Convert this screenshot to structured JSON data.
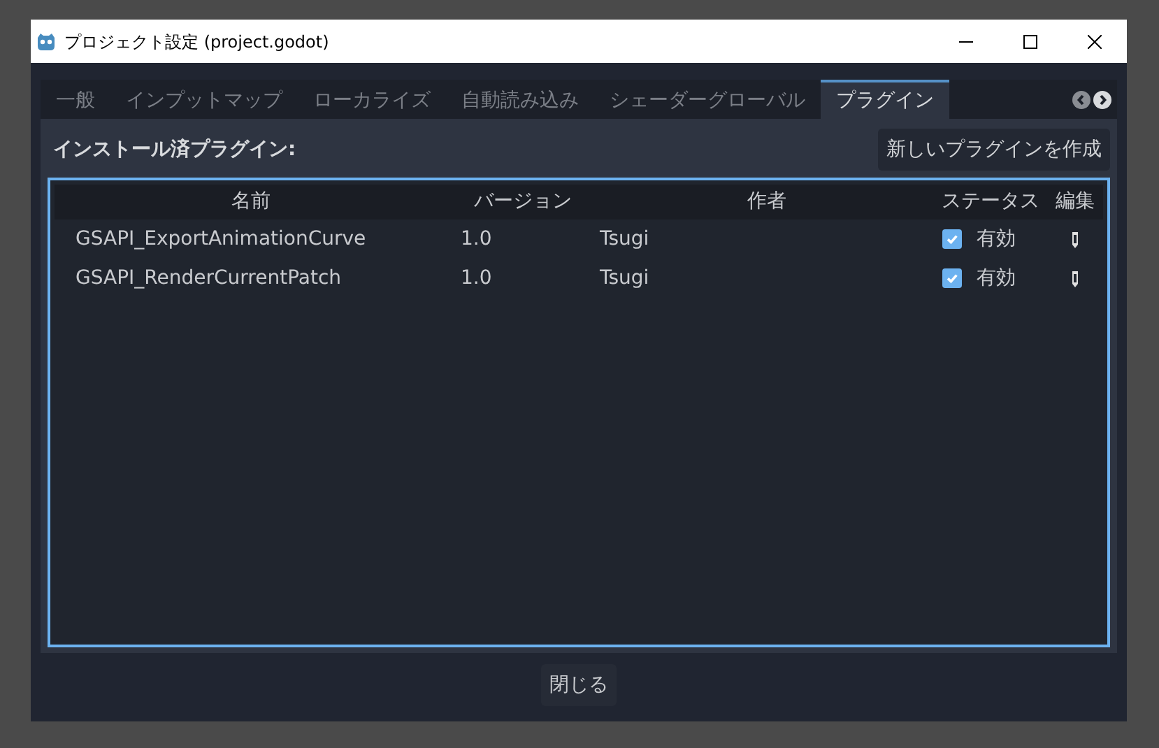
{
  "window": {
    "title": "プロジェクト設定 (project.godot)"
  },
  "tabs": [
    {
      "label": "一般",
      "selected": false
    },
    {
      "label": "インプットマップ",
      "selected": false
    },
    {
      "label": "ローカライズ",
      "selected": false
    },
    {
      "label": "自動読み込み",
      "selected": false
    },
    {
      "label": "シェーダーグローバル",
      "selected": false
    },
    {
      "label": "プラグイン",
      "selected": true
    }
  ],
  "section_title": "インストール済プラグイン:",
  "create_button": "新しいプラグインを作成",
  "table": {
    "columns": [
      "名前",
      "バージョン",
      "作者",
      "ステータス",
      "編集"
    ],
    "rows": [
      {
        "name": "GSAPI_ExportAnimationCurve",
        "version": "1.0",
        "author": "Tsugi",
        "checked": true,
        "status": "有効"
      },
      {
        "name": "GSAPI_RenderCurrentPatch",
        "version": "1.0",
        "author": "Tsugi",
        "checked": true,
        "status": "有効"
      }
    ]
  },
  "close_button": "閉じる"
}
